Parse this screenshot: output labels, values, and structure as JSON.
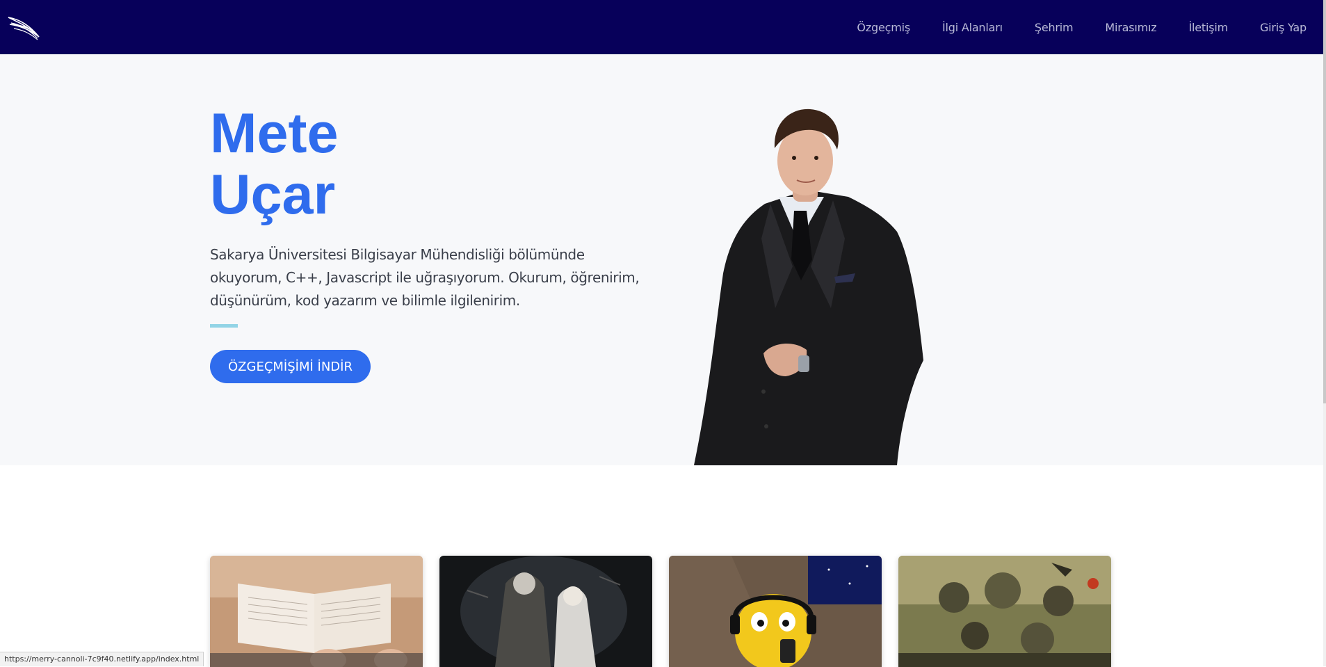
{
  "nav": {
    "logo_icon": "wing-icon",
    "items": [
      {
        "label": "Özgeçmiş"
      },
      {
        "label": "İlgi Alanları"
      },
      {
        "label": "Şehrim"
      },
      {
        "label": "Mirasımız"
      },
      {
        "label": "İletişim"
      },
      {
        "label": "Giriş Yap"
      }
    ]
  },
  "hero": {
    "first_name": "Mete",
    "last_name": "Uçar",
    "bio": "Sakarya Üniversitesi Bilgisayar Mühendisliği bölümünde okuyorum, C++, Javascript ile uğraşıyorum. Okurum, öğrenirim, düşünürüm, kod yazarım ve bilimle ilgilenirim.",
    "cta_label": "ÖZGEÇMİŞİMİ İNDİR"
  },
  "cards": [
    {
      "image": "open-book-photo"
    },
    {
      "image": "witcher-artwork"
    },
    {
      "image": "cartoon-podcast-illustration"
    },
    {
      "image": "fantasy-movie-poster"
    }
  ],
  "status_bar": {
    "url": "https://merry-cannoli-7c9f40.netlify.app/index.html"
  },
  "colors": {
    "navbar": "#07005a",
    "accent": "#2f6ced",
    "hero_bg": "#f7f8fa",
    "accent_line": "#92d4e6"
  }
}
